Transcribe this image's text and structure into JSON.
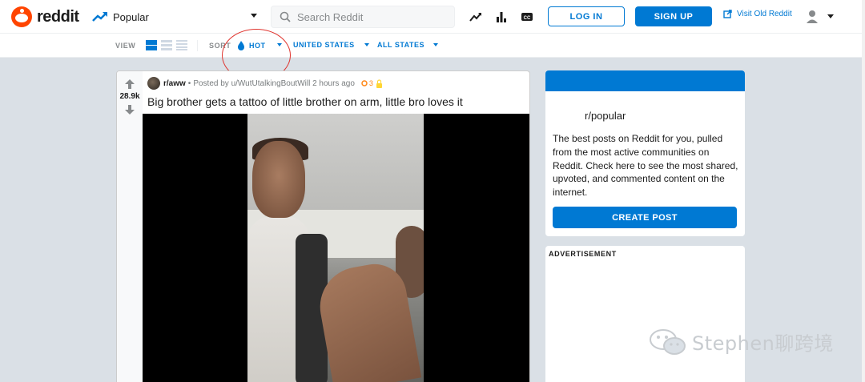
{
  "header": {
    "logo_text": "reddit",
    "feed_label": "Popular",
    "search_placeholder": "Search Reddit",
    "login_label": "LOG IN",
    "signup_label": "SIGN UP",
    "old_reddit_label": "Visit Old Reddit",
    "icons": [
      "trending-icon",
      "stats-icon",
      "cc-icon",
      "user-icon"
    ]
  },
  "sortbar": {
    "view_label": "VIEW",
    "sort_label": "SORT",
    "sort_value": "HOT",
    "country": "UNITED STATES",
    "state": "ALL STATES"
  },
  "post": {
    "votes": "28.9k",
    "subreddit": "r/aww",
    "posted_by": "Posted by u/WutUtalkingBoutWill 2 hours ago",
    "award_count": "3",
    "title": "Big brother gets a tattoo of little brother on arm, little bro loves it"
  },
  "sidebar": {
    "title": "r/popular",
    "description": "The best posts on Reddit for you, pulled from the most active communities on Reddit. Check here to see the most shared, upvoted, and commented content on the internet.",
    "create_post_label": "CREATE POST",
    "ad_label": "ADVERTISEMENT"
  },
  "watermark": {
    "text": "Stephen聊跨境"
  },
  "colors": {
    "brand": "#ff4500",
    "accent": "#0079d3",
    "background": "#dae0e6",
    "annotation": "#e0352f"
  }
}
